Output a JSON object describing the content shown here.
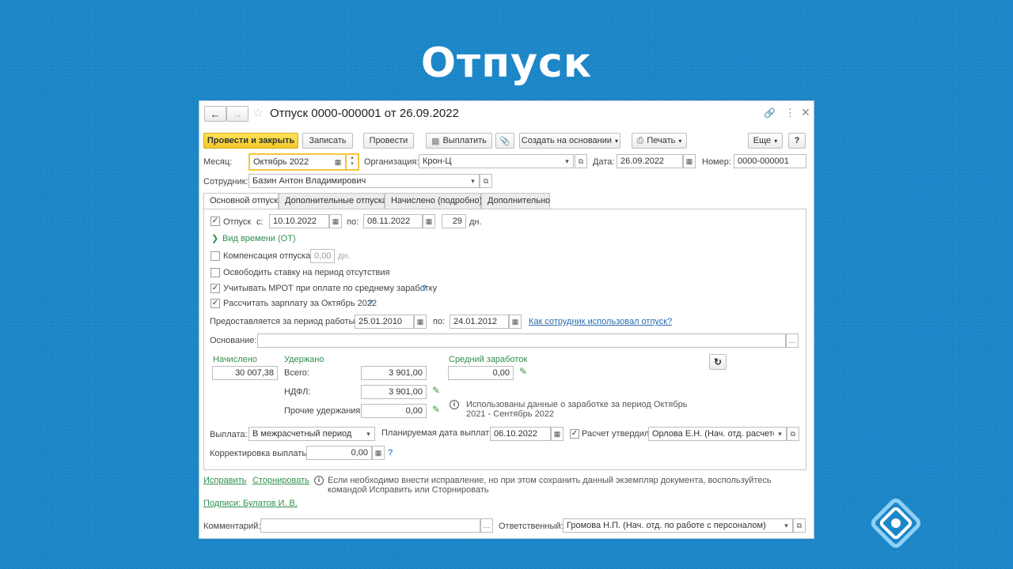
{
  "slide": {
    "title": "Отпуск"
  },
  "window": {
    "title": "Отпуск 0000-000001 от 26.09.2022"
  },
  "toolbar": {
    "post_close": "Провести и закрыть",
    "save": "Записать",
    "post": "Провести",
    "pay": "Выплатить",
    "create_based": "Создать на основании",
    "print": "Печать",
    "more": "Еще",
    "help": "?"
  },
  "header": {
    "month_label": "Месяц:",
    "month_value": "Октябрь 2022",
    "org_label": "Организация:",
    "org_value": "Крон-Ц",
    "date_label": "Дата:",
    "date_value": "26.09.2022",
    "number_label": "Номер:",
    "number_value": "0000-000001",
    "employee_label": "Сотрудник:",
    "employee_value": "Базин Антон Владимирович"
  },
  "tabs": [
    {
      "label": "Основной отпуск"
    },
    {
      "label": "Дополнительные отпуска"
    },
    {
      "label": "Начислено (подробно)"
    },
    {
      "label": "Дополнительно"
    }
  ],
  "main": {
    "vacation_label": "Отпуск",
    "from_label": "с:",
    "from_value": "10.10.2022",
    "to_label": "по:",
    "to_value": "08.11.2022",
    "days_value": "29",
    "days_unit": "дн.",
    "time_type": "Вид времени (ОТ)",
    "compensation_label": "Компенсация отпуска",
    "compensation_value": "0,00",
    "compensation_unit": "дн.",
    "free_rate_label": "Освободить ставку на период отсутствия",
    "mrot_label": "Учитывать МРОТ при оплате по среднему заработку",
    "calc_salary_label": "Рассчитать зарплату за Октябрь 2022",
    "period_label": "Предоставляется за период работы с:",
    "period_from": "25.01.2010",
    "period_to_label": "по:",
    "period_to": "24.01.2012",
    "usage_link": "Как сотрудник использовал отпуск?",
    "basis_label": "Основание:",
    "accrued_label": "Начислено",
    "accrued_value": "30 007,38",
    "withheld_label": "Удержано",
    "total_label": "Всего:",
    "total_value": "3 901,00",
    "ndfl_label": "НДФЛ:",
    "ndfl_value": "3 901,00",
    "other_label": "Прочие удержания:",
    "other_value": "0,00",
    "avg_label": "Средний заработок",
    "avg_value": "0,00",
    "info_text": "Использованы данные о заработке за период Октябрь 2021 - Сентябрь 2022",
    "payout_label": "Выплата:",
    "payout_value": "В межрасчетный период",
    "planned_date_label": "Планируемая дата выплаты:",
    "planned_date_value": "06.10.2022",
    "approved_label": "Расчет утвердил",
    "approved_value": "Орлова Е.Н. (Нач. отд. расчетов",
    "correction_label": "Корректировка выплаты:",
    "correction_value": "0,00"
  },
  "footer": {
    "fix_link": "Исправить",
    "reverse_link": "Сторнировать",
    "fix_info": "Если необходимо внести исправление, но при этом сохранить данный экземпляр документа, воспользуйтесь командой Исправить или Сторнировать",
    "signatures_link": "Подписи: Булатов И. В.",
    "comment_label": "Комментарий:",
    "responsible_label": "Ответственный:",
    "responsible_value": "Громова Н.П. (Нач. отд. по работе с персоналом)"
  }
}
